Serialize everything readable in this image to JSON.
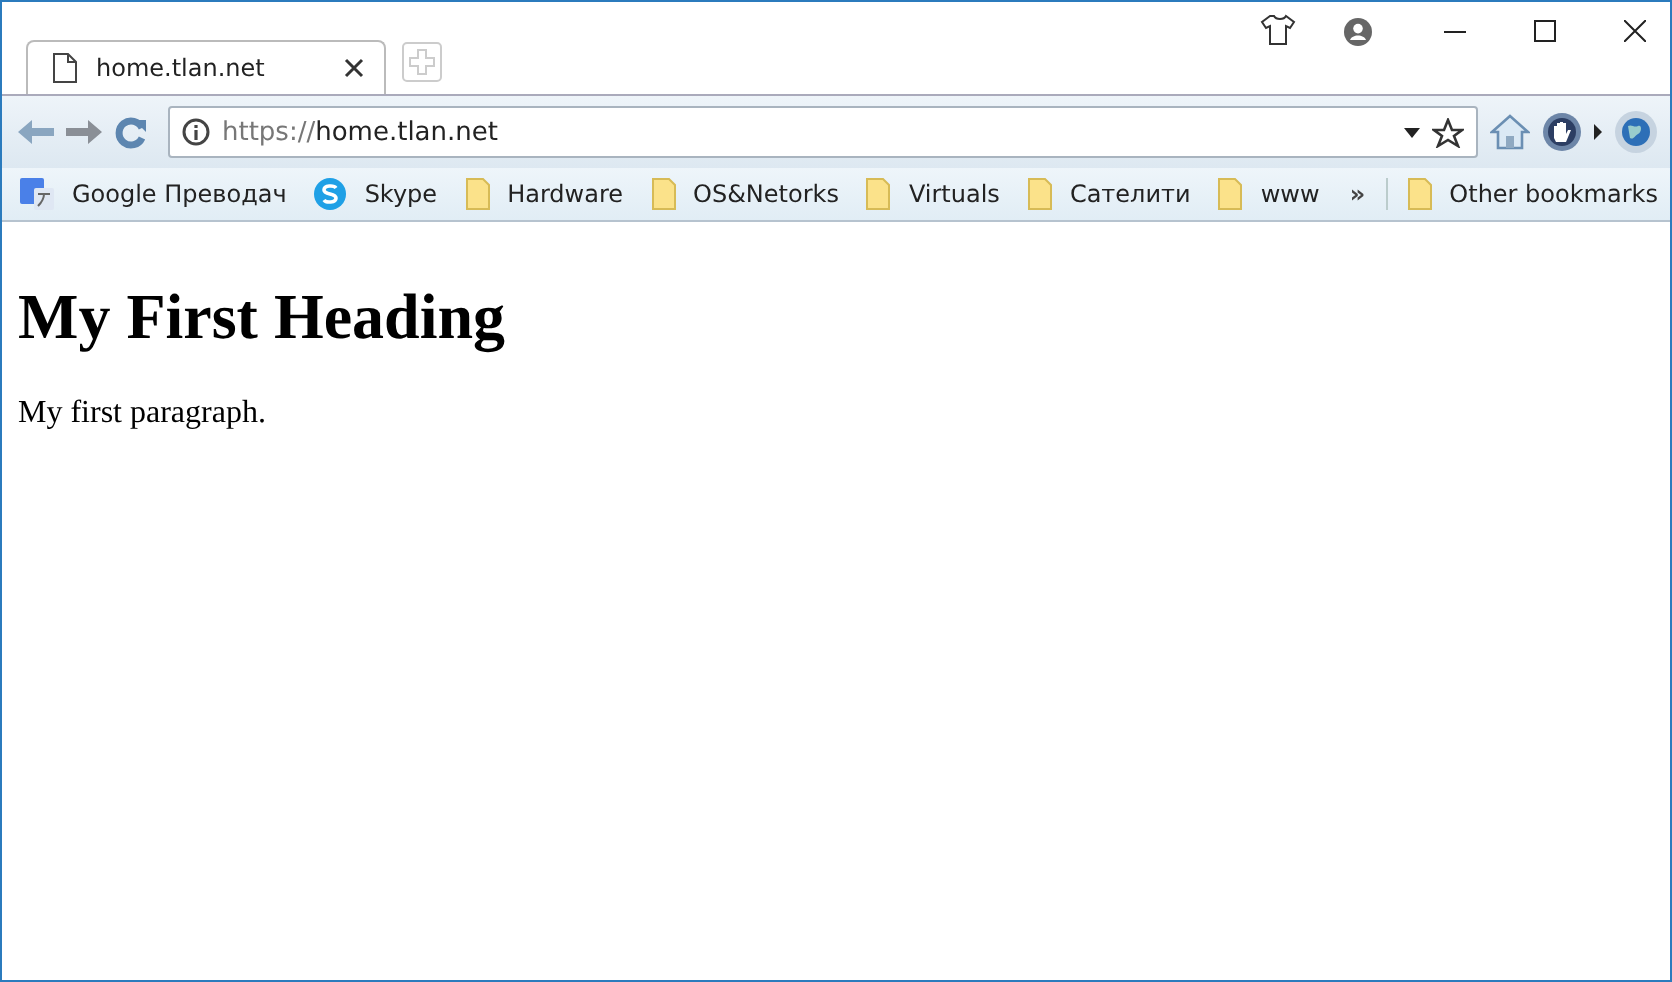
{
  "tabs": [
    {
      "title": "home.tlan.net",
      "selected": true
    }
  ],
  "address_bar": {
    "scheme": "https://",
    "host": "home.tlan.net"
  },
  "bookmarks": [
    {
      "kind": "translate",
      "label": "Google Преводач"
    },
    {
      "kind": "skype",
      "label": "Skype"
    },
    {
      "kind": "folder",
      "label": "Hardware"
    },
    {
      "kind": "folder",
      "label": "OS&Netorks"
    },
    {
      "kind": "folder",
      "label": "Virtuals"
    },
    {
      "kind": "folder",
      "label": "Сателити"
    },
    {
      "kind": "folder",
      "label": "www"
    }
  ],
  "bookmarks_overflow": "»",
  "other_bookmarks": "Other bookmarks",
  "page": {
    "heading": "My First Heading",
    "paragraph": "My first paragraph."
  }
}
